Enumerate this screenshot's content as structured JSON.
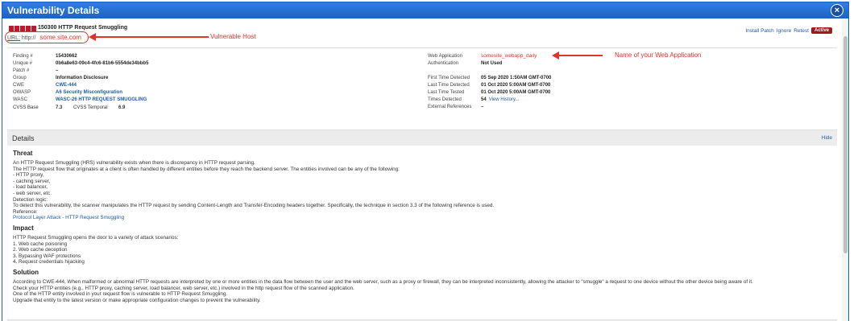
{
  "window": {
    "title": "Vulnerability Details",
    "close_label": "×"
  },
  "header": {
    "severity_levels": 5,
    "qid_title": "150300  HTTP Request Smuggling",
    "url_label": "URL:",
    "url_prefix": "http://",
    "url_host": "some.site.com",
    "actions": {
      "install_patch": "Install Patch",
      "ignore": "Ignore",
      "retest": "Retest",
      "status": "Active"
    }
  },
  "annotations": {
    "vulnerable_host": "Vulnerable Host",
    "web_app_name": "Name of your Web Application"
  },
  "left_fields": [
    {
      "key": "Finding #",
      "value": "15430662"
    },
    {
      "key": "Unique #",
      "value": "0b6a8e63-09c4-4fc6-81b6-5554de34bbb5"
    },
    {
      "key": "Patch #",
      "value": "–"
    },
    {
      "key": "Group",
      "value": "Information Disclosure"
    },
    {
      "key": "CWE",
      "value": "CWE-444"
    },
    {
      "key": "OWASP",
      "value": "A6 Security Misconfiguration"
    },
    {
      "key": "WASC",
      "value": "WASC-26 HTTP REQUEST SMUGGLING"
    }
  ],
  "cvss": {
    "base_label": "CVSS Base",
    "base_value": "7.3",
    "temporal_label": "CVSS Temporal",
    "temporal_value": "6.9"
  },
  "right_fields": {
    "web_application": {
      "key": "Web Application",
      "value": "somesite_webapp_daily"
    },
    "authentication": {
      "key": "Authentication",
      "value": "Not Used"
    },
    "first_detected": {
      "key": "First Time Detected",
      "value": "05 Sep 2020 1:50AM GMT-0700"
    },
    "last_detected": {
      "key": "Last Time Detected",
      "value": "01 Oct 2020 5:00AM GMT-0700"
    },
    "last_tested": {
      "key": "Last Time Tested",
      "value": "01 Oct 2020 5:00AM GMT-0700"
    },
    "times_detected": {
      "key": "Times Detected",
      "value": "54",
      "link": "View History..."
    },
    "external_refs": {
      "key": "External References",
      "value": "–"
    }
  },
  "details": {
    "header": "Details",
    "hide": "Hide",
    "threat": {
      "title": "Threat",
      "lines": [
        "An HTTP Request Smuggling (HRS) vulnerability exists when there is discrepancy in HTTP request parsing.",
        "The HTTP request flow that originates at a client is often handled by different entities before they reach the backend server. The entities involved can be any of the following:",
        "- HTTP proxy,",
        "- caching server,",
        "- load balancer,",
        "- web server, etc.",
        "Detection logic:",
        "To detect this vulnerability, the scanner manipulates the HTTP request by sending Content-Length and Transfer-Encoding headers together. Specifically, the technique in section 3.3 of the following reference is used.",
        "Reference:"
      ],
      "link": "Protocol Layer Attack - HTTP Request Smuggling"
    },
    "impact": {
      "title": "Impact",
      "lines": [
        "HTTP Request Smuggling opens the door to a variety of attack scenarios:",
        "1. Web cache poisoning",
        "2. Web cache deception",
        "3. Bypassing WAF protections",
        "4. Request credentials hijacking"
      ]
    },
    "solution": {
      "title": "Solution",
      "lines": [
        "According to CWE-444, When malformed or abnormal HTTP requests are interpreted by one or more entities in the data flow between the user and the web server, such as a proxy or firewall, they can be interpreted inconsistently, allowing the attacker to \"smuggle\" a request to one device without the other device being aware of it.",
        "Check your HTTP entities (e.g., HTTP proxy, caching server, load balancer, web server, etc.) involved in the http request flow of the scanned application.",
        "One of the HTTP entity involved in your request flow is vulnerable to HTTP Request Smuggling.",
        "Upgrade that entity to the latest version or make appropriate configuration changes to prevent the vulnerability."
      ]
    }
  }
}
